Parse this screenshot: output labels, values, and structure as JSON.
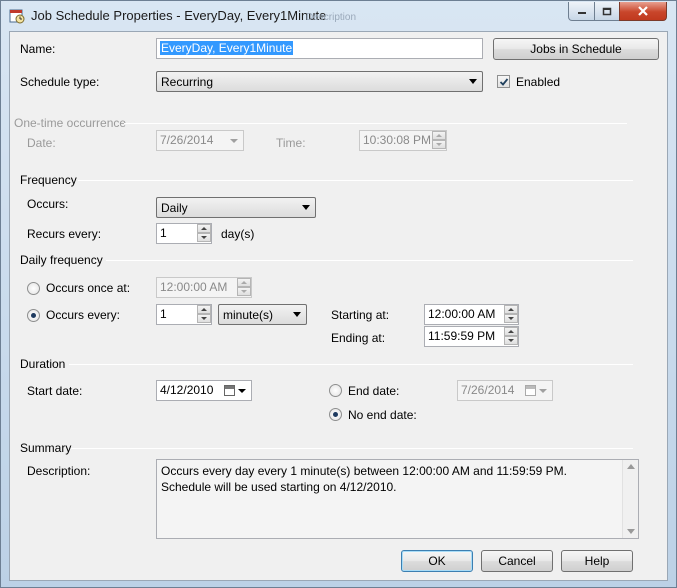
{
  "window": {
    "title": "Job Schedule Properties - EveryDay, Every1Minute",
    "ghost_title": "Description"
  },
  "general": {
    "name_label": "Name:",
    "name_value": "EveryDay, Every1Minute",
    "jobs_button": "Jobs in Schedule",
    "schedule_type_label": "Schedule type:",
    "schedule_type_value": "Recurring",
    "enabled_label": "Enabled",
    "enabled_checked": true
  },
  "one_time": {
    "section": "One-time occurrence",
    "date_label": "Date:",
    "date_value": "7/26/2014",
    "time_label": "Time:",
    "time_value": "10:30:08 PM"
  },
  "frequency": {
    "section": "Frequency",
    "occurs_label": "Occurs:",
    "occurs_value": "Daily",
    "recurs_label": "Recurs every:",
    "recurs_value": "1",
    "recurs_unit": "day(s)"
  },
  "daily_frequency": {
    "section": "Daily frequency",
    "once_label": "Occurs once at:",
    "once_value": "12:00:00 AM",
    "every_label": "Occurs every:",
    "every_value": "1",
    "every_unit": "minute(s)",
    "starting_label": "Starting at:",
    "starting_value": "12:00:00 AM",
    "ending_label": "Ending at:",
    "ending_value": "11:59:59 PM",
    "selected": "every"
  },
  "duration": {
    "section": "Duration",
    "start_label": "Start date:",
    "start_value": "4/12/2010",
    "end_label": "End date:",
    "end_value": "7/26/2014",
    "no_end_label": "No end date:",
    "selected": "no_end"
  },
  "summary": {
    "section": "Summary",
    "description_label": "Description:",
    "description_text": "Occurs every day every 1 minute(s) between 12:00:00 AM and 11:59:59 PM. Schedule will be used starting on 4/12/2010."
  },
  "buttons": {
    "ok": "OK",
    "cancel": "Cancel",
    "help": "Help"
  },
  "colors": {
    "selection": "#3399ff",
    "disabled_text": "#9a9a9a",
    "close_button": "#c9462b"
  }
}
